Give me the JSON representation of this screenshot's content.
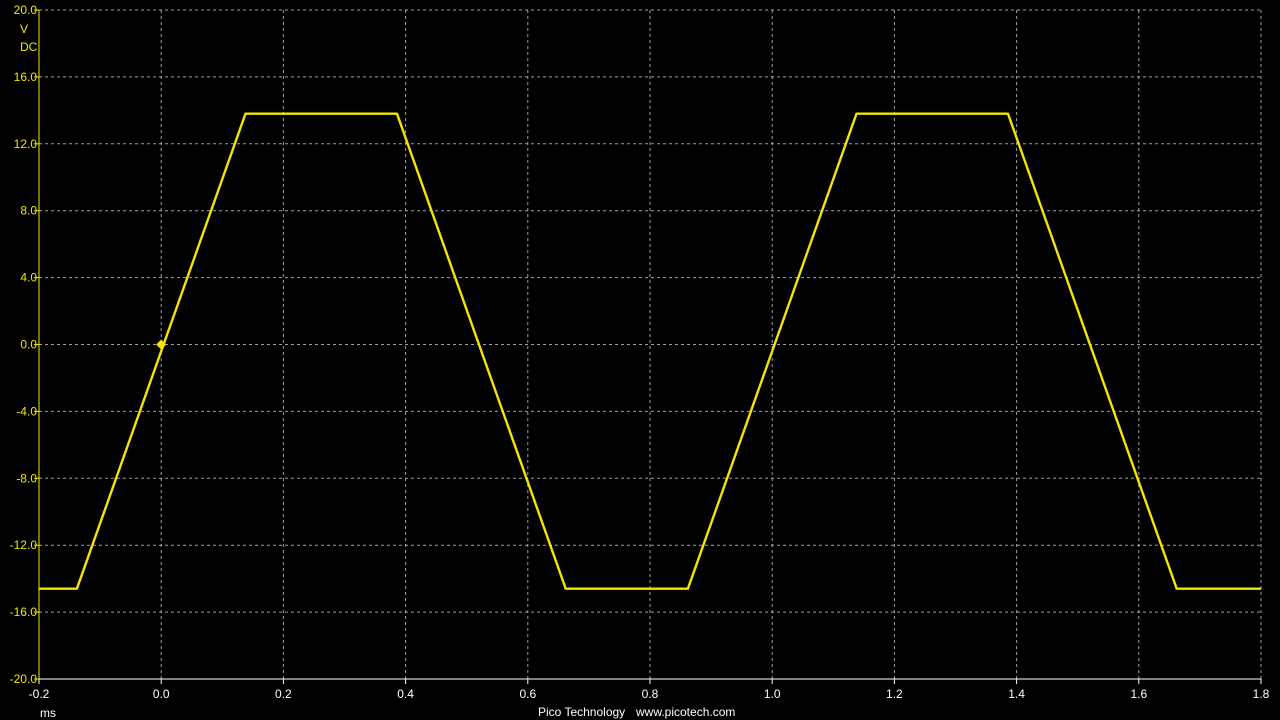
{
  "chart_data": {
    "type": "line",
    "title": "",
    "y_unit": "V",
    "coupling": "DC",
    "x_unit": "ms",
    "xlim": [
      -0.2,
      1.8
    ],
    "ylim": [
      -20.0,
      20.0
    ],
    "x_ticks": [
      "-0.2",
      "0.0",
      "0.2",
      "0.4",
      "0.6",
      "0.8",
      "1.0",
      "1.2",
      "1.4",
      "1.6",
      "1.8"
    ],
    "y_ticks": [
      "20.0",
      "16.0",
      "12.0",
      "8.0",
      "4.0",
      "0.0",
      "-4.0",
      "-8.0",
      "-12.0",
      "-16.0",
      "-20.0"
    ],
    "grid": true,
    "series": [
      {
        "color": "#f2e600",
        "x": [
          -0.2,
          -0.138,
          0.138,
          0.386,
          0.662,
          0.862,
          1.138,
          1.386,
          1.662,
          1.8
        ],
        "y": [
          -14.6,
          -14.6,
          13.8,
          13.8,
          -14.6,
          -14.6,
          13.8,
          13.8,
          -14.6,
          -14.6
        ]
      }
    ],
    "trigger_marker": {
      "x": 0.0,
      "y": 0.0,
      "color": "#f2e600"
    }
  },
  "footer": {
    "brand": "Pico Technology",
    "url": "www.picotech.com"
  }
}
